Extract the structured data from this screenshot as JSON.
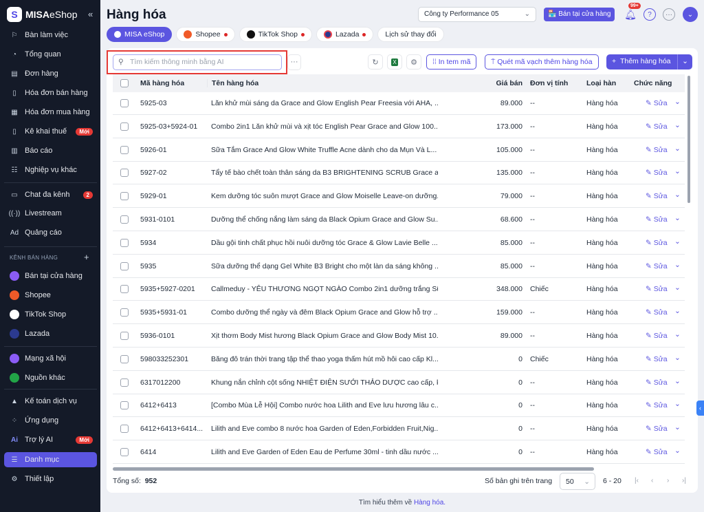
{
  "sidebar": {
    "brand_bold": "MISA",
    "brand_light": "eShop",
    "items": [
      {
        "label": "Bàn làm việc",
        "icon": "desk-icon"
      },
      {
        "label": "Tổng quan",
        "icon": "dashboard-icon"
      },
      {
        "label": "Đơn hàng",
        "icon": "order-icon"
      },
      {
        "label": "Hóa đơn bán hàng",
        "icon": "invoice-icon"
      },
      {
        "label": "Hóa đơn mua hàng",
        "icon": "purchase-invoice-icon"
      },
      {
        "label": "Kê khai thuế",
        "icon": "tax-icon",
        "badge": "Mới"
      },
      {
        "label": "Báo cáo",
        "icon": "report-icon"
      },
      {
        "label": "Nghiệp vụ khác",
        "icon": "list-icon"
      },
      {
        "label": "Chat đa kênh",
        "icon": "chat-icon",
        "badge": "2"
      },
      {
        "label": "Livestream",
        "icon": "livestream-icon"
      },
      {
        "label": "Quảng cáo",
        "icon": "ad-icon"
      }
    ],
    "channels_title": "KÊNH BÁN HÀNG",
    "channels": [
      {
        "label": "Bán tại cửa hàng",
        "color": "#8b5cf6"
      },
      {
        "label": "Shopee",
        "color": "#f05a28"
      },
      {
        "label": "TikTok Shop",
        "color": "#ffffff"
      },
      {
        "label": "Lazada",
        "color": "#2b3a8f"
      }
    ],
    "others": [
      {
        "label": "Mạng xã hội",
        "color": "#8b5cf6"
      },
      {
        "label": "Nguồn khác",
        "color": "#22a447"
      }
    ],
    "bottom": [
      {
        "label": "Kế toán dịch vụ",
        "icon": "accounting-icon"
      },
      {
        "label": "Ứng dụng",
        "icon": "apps-icon"
      },
      {
        "label": "Trợ lý AI",
        "icon": "ai-icon",
        "badge": "Mới"
      },
      {
        "label": "Danh mục",
        "icon": "catalog-icon",
        "active": true
      },
      {
        "label": "Thiết lập",
        "icon": "settings-icon"
      }
    ]
  },
  "header": {
    "title": "Hàng hóa",
    "company": "Công ty Performance 05",
    "store_button": "Bán tại cửa hàng",
    "notifications": "99+"
  },
  "tabs": [
    {
      "label": "MISA eShop"
    },
    {
      "label": "Shopee"
    },
    {
      "label": "TikTok Shop"
    },
    {
      "label": "Lazada"
    },
    {
      "label": "Lịch sử thay đổi"
    }
  ],
  "toolbar": {
    "search_placeholder": "Tìm kiếm thông minh bằng AI",
    "print_label": "In tem mã",
    "scan_label": "Quét mã vạch thêm hàng hóa",
    "add_label": "Thêm hàng hóa"
  },
  "table": {
    "columns": [
      "Mã hàng hóa",
      "Tên hàng hóa",
      "Giá bán",
      "Đơn vị tính",
      "Loại hàn",
      "Chức năng"
    ],
    "edit_label": "Sửa",
    "rows": [
      [
        "5925-03",
        "Lăn khử mùi sáng da Grace and Glow English Pear Freesia với AHA, ...",
        "89.000",
        "--",
        "Hàng hóa"
      ],
      [
        "5925-03+5924-01",
        "Combo 2in1 Lăn khử mùi và xịt tóc English Pear Grace and Glow 100...",
        "173.000",
        "--",
        "Hàng hóa"
      ],
      [
        "5926-01",
        "Sữa Tắm Grace And Glow White Truffle Acne dành cho da Mụn Và L...",
        "105.000",
        "--",
        "Hàng hóa"
      ],
      [
        "5927-02",
        "Tẩy tế bào chết toàn thân sáng da B3 BRIGHTENING SCRUB Grace a...",
        "135.000",
        "--",
        "Hàng hóa"
      ],
      [
        "5929-01",
        "Kem dưỡng tóc suôn mượt Grace and Glow Moiselle Leave-on dưỡng...",
        "79.000",
        "--",
        "Hàng hóa"
      ],
      [
        "5931-0101",
        "Dưỡng thể chống nắng làm sáng da Black Opium Grace and Glow Su...",
        "68.600",
        "--",
        "Hàng hóa"
      ],
      [
        "5934",
        "Dầu gội tinh chất phục hồi nuôi dưỡng tóc Grace & Glow Lavie Belle ...",
        "85.000",
        "--",
        "Hàng hóa"
      ],
      [
        "5935",
        "Sữa dưỡng thể dạng Gel White B3 Bright cho một làn da sáng không ...",
        "85.000",
        "--",
        "Hàng hóa"
      ],
      [
        "5935+5927-0201",
        "Callmeduy - YÊU THƯƠNG NGỌT NGÀO Combo 2in1 dưỡng trắng Sữ...",
        "348.000",
        "Chiếc",
        "Hàng hóa"
      ],
      [
        "5935+5931-01",
        "Combo dưỡng thể ngày và đêm Black Opium Grace and Glow hỗ trợ ...",
        "159.000",
        "--",
        "Hàng hóa"
      ],
      [
        "5936-0101",
        "Xịt thơm Body Mist hương Black Opium Grace and Glow Body Mist 10...",
        "89.000",
        "--",
        "Hàng hóa"
      ],
      [
        "598033252301",
        "Băng đô trán thời trang tập thể thao yoga thấm hút mồ hôi cao cấp Kl...",
        "0",
        "Chiếc",
        "Hàng hóa"
      ],
      [
        "6317012200",
        "Khung nắn chỉnh cột sống NHIỆT ĐIỆN SƯỞI THẢO DƯỢC cao cấp, k...",
        "0",
        "--",
        "Hàng hóa"
      ],
      [
        "6412+6413",
        "[Combo Mùa Lễ Hội] Combo nước hoa Lilith and Eve lưu hương lâu c...",
        "0",
        "--",
        "Hàng hóa"
      ],
      [
        "6412+6413+6414...",
        "Lilith and Eve combo 8 nước hoa Garden of Eden,Forbidden Fruit,Nig...",
        "0",
        "--",
        "Hàng hóa"
      ],
      [
        "6414",
        "Lilith and Eve Garden of Eden Eau de Perfume 30ml - tinh dầu nước ...",
        "0",
        "--",
        "Hàng hóa"
      ]
    ]
  },
  "footer": {
    "total_label": "Tổng số:",
    "total": "952",
    "per_page_label": "Số bản ghi trên trang",
    "per_page": "50",
    "range": "6 - 20",
    "learn_prefix": "Tìm hiểu thêm về",
    "learn_link": "Hàng hóa."
  },
  "colors": {
    "accent": "#5b55e0",
    "sidebar": "#141a28"
  }
}
